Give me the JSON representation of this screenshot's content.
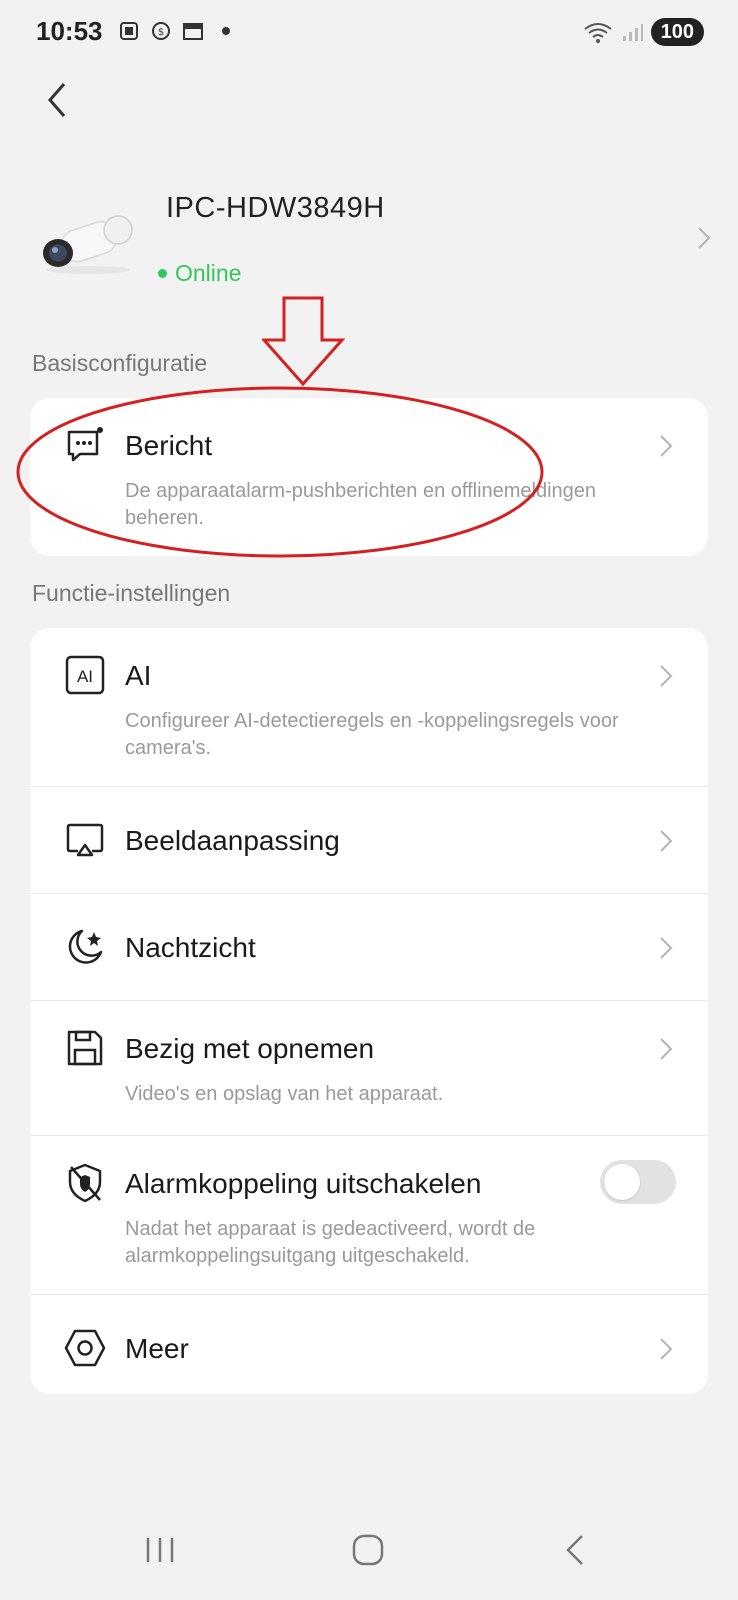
{
  "status_bar": {
    "time": "10:53",
    "battery": "100",
    "icons": [
      "screenshot-icon",
      "data-saver-icon",
      "calendar-icon",
      "wifi-icon",
      "signal-icon"
    ]
  },
  "device": {
    "name": "IPC-HDW3849H",
    "status": "Online",
    "status_color": "#34c55e"
  },
  "sections": {
    "basic": {
      "title": "Basisconfiguratie",
      "items": [
        {
          "title": "Bericht",
          "description": "De apparaatalarm-pushberichten en offlinemeldingen beheren.",
          "icon": "message-icon"
        }
      ]
    },
    "functions": {
      "title": "Functie-instellingen",
      "items": [
        {
          "title": "AI",
          "description": "Configureer AI-detectieregels en -koppelingsregels voor camera's.",
          "icon": "ai-icon"
        },
        {
          "title": "Beeldaanpassing",
          "description": "",
          "icon": "image-adjust-icon"
        },
        {
          "title": "Nachtzicht",
          "description": "",
          "icon": "night-vision-icon"
        },
        {
          "title": "Bezig met opnemen",
          "description": "Video's en opslag van het apparaat.",
          "icon": "save-icon"
        },
        {
          "title": "Alarmkoppeling uitschakelen",
          "description": "Nadat het apparaat is gedeactiveerd, wordt de alarmkoppelingsuitgang uitgeschakeld.",
          "icon": "shield-off-icon",
          "toggle": false
        },
        {
          "title": "Meer",
          "description": "",
          "icon": "hexagon-settings-icon"
        }
      ]
    }
  },
  "annotation_color": "#d42020",
  "colors": {
    "background": "#f2f2f2",
    "card": "#ffffff",
    "online": "#34c55e"
  }
}
